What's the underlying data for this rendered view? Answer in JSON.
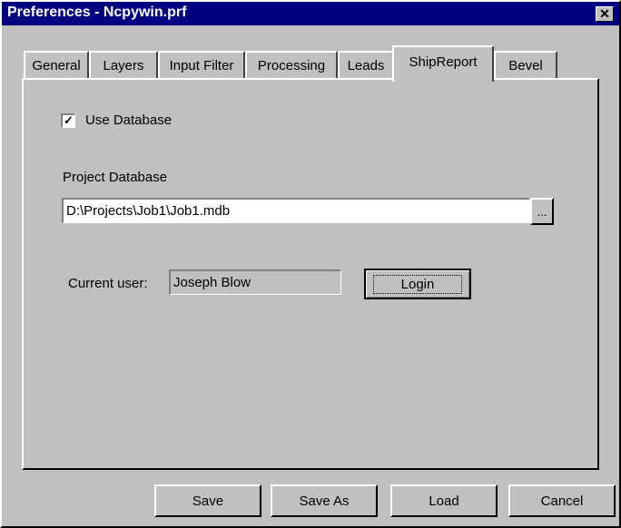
{
  "window": {
    "title": "Preferences - Ncpywin.prf",
    "close_glyph": "✕"
  },
  "tabs": [
    {
      "label": "General"
    },
    {
      "label": "Layers"
    },
    {
      "label": "Input Filter"
    },
    {
      "label": "Processing"
    },
    {
      "label": "Leads"
    },
    {
      "label": "ShipReport",
      "active": true
    },
    {
      "label": "Bevel"
    }
  ],
  "shipreport": {
    "use_database_label": "Use Database",
    "use_database_checked": true,
    "checkmark_glyph": "✓",
    "project_database_label": "Project Database",
    "project_database_value": "D:\\Projects\\Job1\\Job1.mdb",
    "browse_label": "...",
    "current_user_label": "Current user:",
    "current_user_value": "Joseph Blow",
    "login_label": "Login"
  },
  "footer": {
    "save_label": "Save",
    "save_as_label": "Save As",
    "load_label": "Load",
    "cancel_label": "Cancel"
  }
}
